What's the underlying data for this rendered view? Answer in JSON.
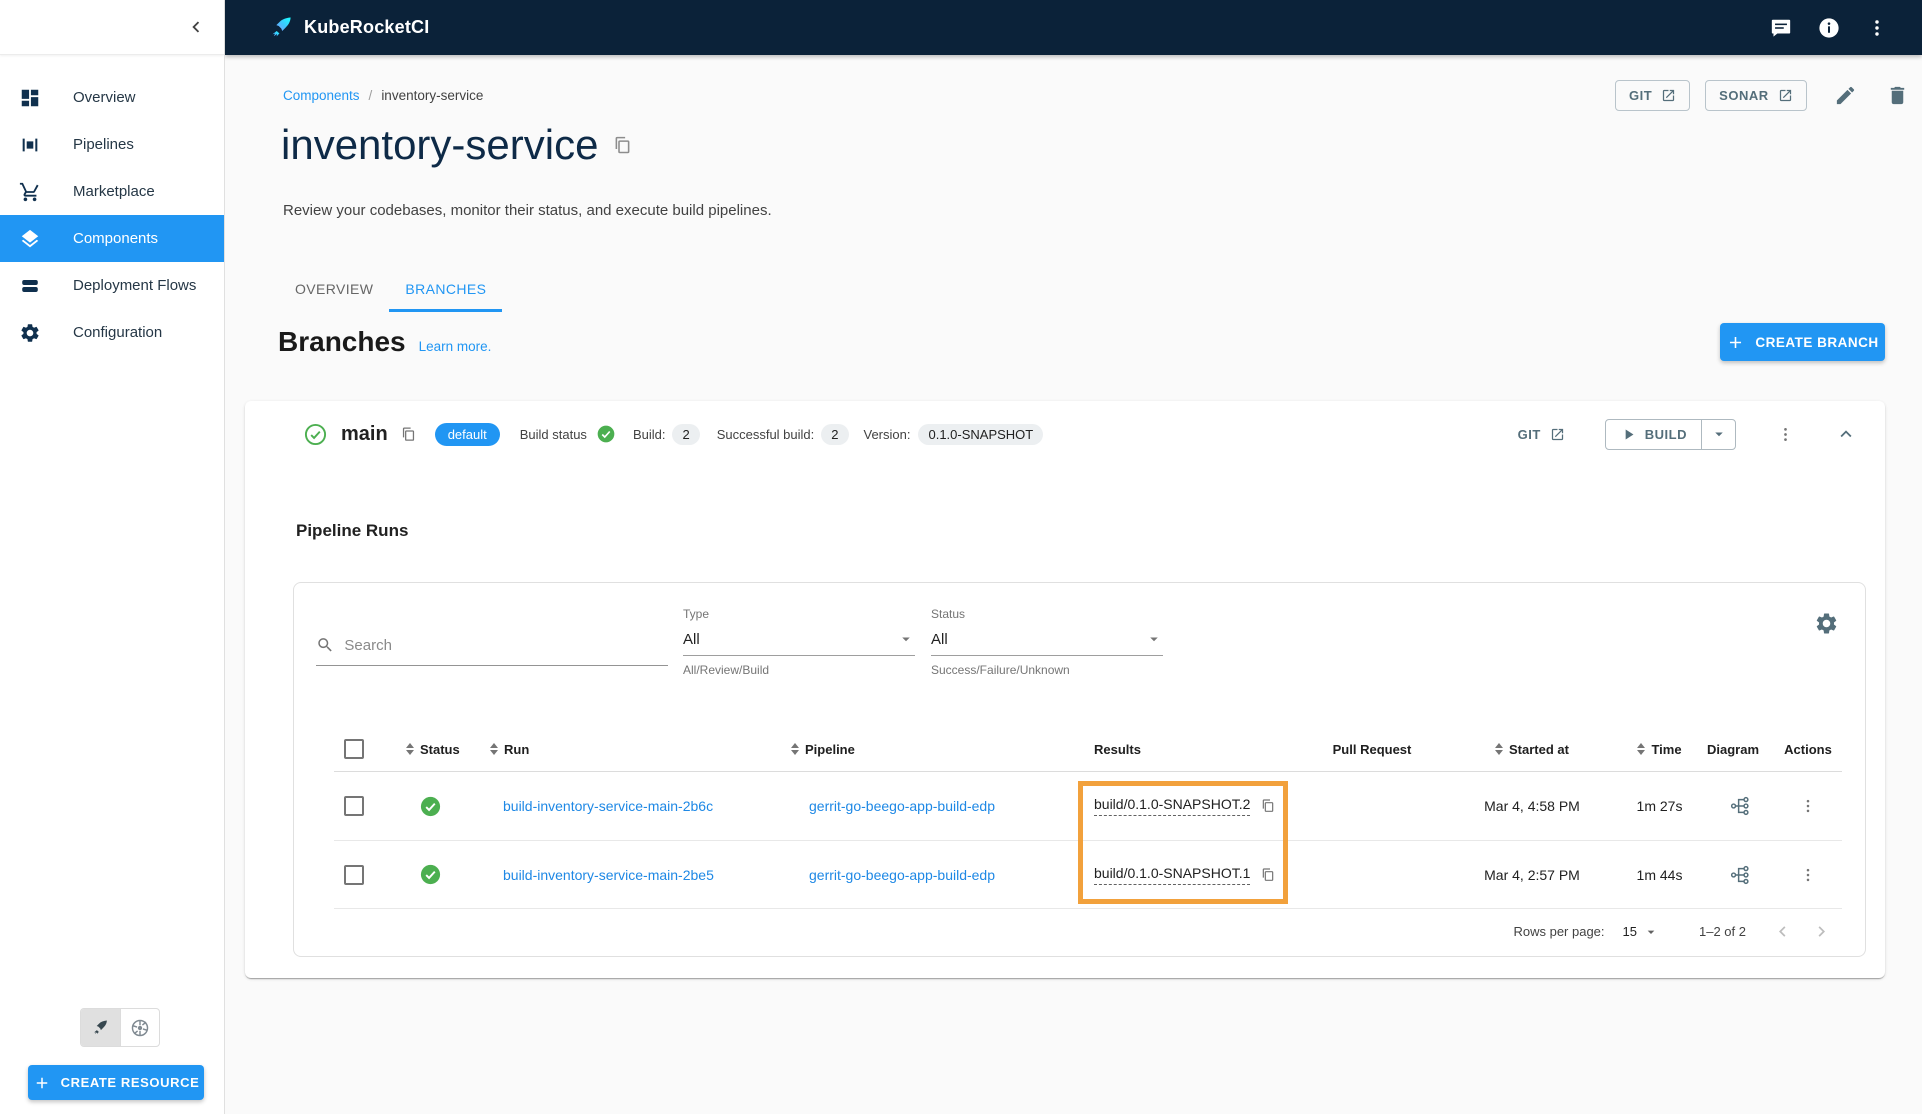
{
  "topbar": {
    "title": "KubeRocketCI",
    "icons": [
      "chat-icon",
      "info-icon",
      "kebab-menu-icon"
    ]
  },
  "sidebar": {
    "items": [
      {
        "label": "Overview",
        "icon": "dashboard-icon",
        "active": false
      },
      {
        "label": "Pipelines",
        "icon": "pipelines-icon",
        "active": false
      },
      {
        "label": "Marketplace",
        "icon": "cart-icon",
        "active": false
      },
      {
        "label": "Components",
        "icon": "layers-icon",
        "active": true
      },
      {
        "label": "Deployment Flows",
        "icon": "stack-icon",
        "active": false
      },
      {
        "label": "Configuration",
        "icon": "gear-icon",
        "active": false
      }
    ],
    "create_resource_label": "CREATE RESOURCE"
  },
  "breadcrumb": {
    "parent": "Components",
    "separator": "/",
    "current": "inventory-service"
  },
  "header": {
    "title": "inventory-service",
    "subtitle": "Review your codebases, monitor their status, and execute build pipelines.",
    "git_button": "GIT",
    "sonar_button": "SONAR"
  },
  "tabs": [
    {
      "label": "OVERVIEW",
      "active": false
    },
    {
      "label": "BRANCHES",
      "active": true
    }
  ],
  "branches_section": {
    "heading": "Branches",
    "learn_more": "Learn more.",
    "create_branch_label": "CREATE BRANCH"
  },
  "branch": {
    "name": "main",
    "default_chip": "default",
    "build_status_label": "Build status",
    "build_label": "Build:",
    "build_count": "2",
    "successful_build_label": "Successful build:",
    "successful_build_count": "2",
    "version_label": "Version:",
    "version": "0.1.0-SNAPSHOT",
    "git_label": "GIT",
    "build_button_label": "BUILD"
  },
  "pipeline_runs": {
    "heading": "Pipeline Runs",
    "search_placeholder": "Search",
    "type_filter": {
      "label": "Type",
      "value": "All",
      "helper": "All/Review/Build"
    },
    "status_filter": {
      "label": "Status",
      "value": "All",
      "helper": "Success/Failure/Unknown"
    },
    "table": {
      "columns": [
        "Status",
        "Run",
        "Pipeline",
        "Results",
        "Pull Request",
        "Started at",
        "Time",
        "Diagram",
        "Actions"
      ],
      "rows": [
        {
          "status": "success",
          "run": "build-inventory-service-main-2b6c",
          "pipeline": "gerrit-go-beego-app-build-edp",
          "result": "build/0.1.0-SNAPSHOT.2",
          "pull_request": "",
          "started_at": "Mar 4, 4:58 PM",
          "time": "1m 27s"
        },
        {
          "status": "success",
          "run": "build-inventory-service-main-2be5",
          "pipeline": "gerrit-go-beego-app-build-edp",
          "result": "build/0.1.0-SNAPSHOT.1",
          "pull_request": "",
          "started_at": "Mar 4, 2:57 PM",
          "time": "1m 44s"
        }
      ]
    },
    "pagination": {
      "rows_per_page_label": "Rows per page:",
      "rows_per_page_value": "15",
      "range": "1–2 of 2"
    }
  },
  "theme": {
    "topbar_bg": "#0b2239",
    "accent_blue": "#2196f3",
    "link_blue": "#1e88e5",
    "success_green": "#4caf50",
    "slate": "#546e7a",
    "highlight_orange": "#f2a13c",
    "page_bg": "#fafafa"
  }
}
